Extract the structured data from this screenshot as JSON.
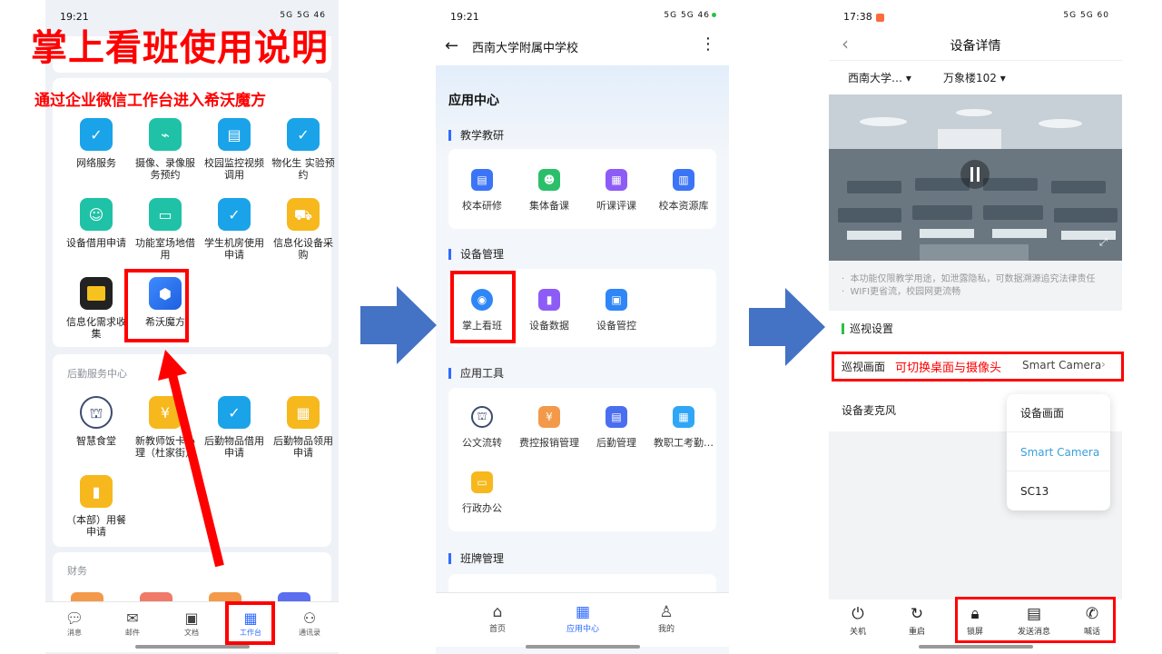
{
  "title": "掌上看班使用说明",
  "subtitle": "通过企业微信工作台进入希沃魔方",
  "phone1": {
    "status_time": "19:21",
    "status_right": "5G 5G 46",
    "apps": [
      {
        "label": "网络服务",
        "icon": "clipboard-icon",
        "color": "#1aa3e8"
      },
      {
        "label": "摄像、录像服务预约",
        "icon": "chart-screen-icon",
        "color": "#1fc2a7"
      },
      {
        "label": "校园监控视频调用",
        "icon": "inbox-icon",
        "color": "#1aa3e8"
      },
      {
        "label": "物化生 实验预约",
        "icon": "clipboard-icon",
        "color": "#1aa3e8"
      },
      {
        "label": "设备借用申请",
        "icon": "hand-icon",
        "color": "#1fc2a7"
      },
      {
        "label": "功能室场地借用",
        "icon": "board-icon",
        "color": "#1fc2a7"
      },
      {
        "label": "学生机房使用申请",
        "icon": "clipboard-icon",
        "color": "#1aa3e8"
      },
      {
        "label": "信息化设备采购",
        "icon": "cart-icon",
        "color": "#f6b81d"
      },
      {
        "label": "信息化需求收集",
        "icon": "image-icon",
        "color": "#222222"
      },
      {
        "label": "希沃魔方",
        "icon": "cube-icon",
        "color": "#2f7cf6"
      }
    ],
    "logistics_label": "后勤服务中心",
    "logistics_apps": [
      {
        "label": "智慧食堂",
        "icon": "school-seal-icon"
      },
      {
        "label": "新教师饭卡办理（杜家街）",
        "icon": "meal-card-icon"
      },
      {
        "label": "后勤物品借用申请",
        "icon": "clipboard-icon"
      },
      {
        "label": "后勤物品领用申请",
        "icon": "calendar-icon"
      },
      {
        "label": "（本部）用餐申请",
        "icon": "ticket-icon"
      }
    ],
    "finance_label": "财务",
    "tabs": [
      "消息",
      "邮件",
      "文档",
      "工作台",
      "通讯录"
    ]
  },
  "phone2": {
    "status_time": "19:21",
    "status_right": "5G 5G 46",
    "school": "西南大学附属中学校",
    "heading": "应用中心",
    "sections": [
      {
        "title": "教学教研",
        "items": [
          "校本研修",
          "集体备课",
          "听课评课",
          "校本资源库"
        ]
      },
      {
        "title": "设备管理",
        "items": [
          "掌上看班",
          "设备数据",
          "设备管控"
        ]
      },
      {
        "title": "应用工具",
        "items": [
          "公文流转",
          "费控报销管理",
          "后勤管理",
          "教职工考勤…",
          "行政办公"
        ]
      },
      {
        "title": "班牌管理",
        "items": []
      }
    ],
    "tabs": [
      "首页",
      "应用中心",
      "我的"
    ]
  },
  "phone3": {
    "status_time": "17:38",
    "status_right": "5G 5G 60",
    "title": "设备详情",
    "filter_school": "西南大学…",
    "filter_room": "万象楼102",
    "notice_lines": [
      "本功能仅限教学用途，如泄露隐私，可数据溯源追究法律责任",
      "WIFI更省流，校园网更流畅"
    ],
    "patrol_section": "巡视设置",
    "patrol_label": "巡视画面",
    "patrol_hint": "可切换桌面与摄像头",
    "patrol_value": "Smart Camera",
    "mic_label": "设备麦克风",
    "dropdown": [
      "设备画面",
      "Smart Camera",
      "SC13"
    ],
    "tabs": [
      "关机",
      "重启",
      "锁屏",
      "发送消息",
      "喊话"
    ]
  },
  "colors": {
    "accent_red": "#ff0000",
    "arrow_blue": "#4472c4",
    "brand_blue": "#2f6bff",
    "selected_cyan": "#3aa0d8"
  }
}
